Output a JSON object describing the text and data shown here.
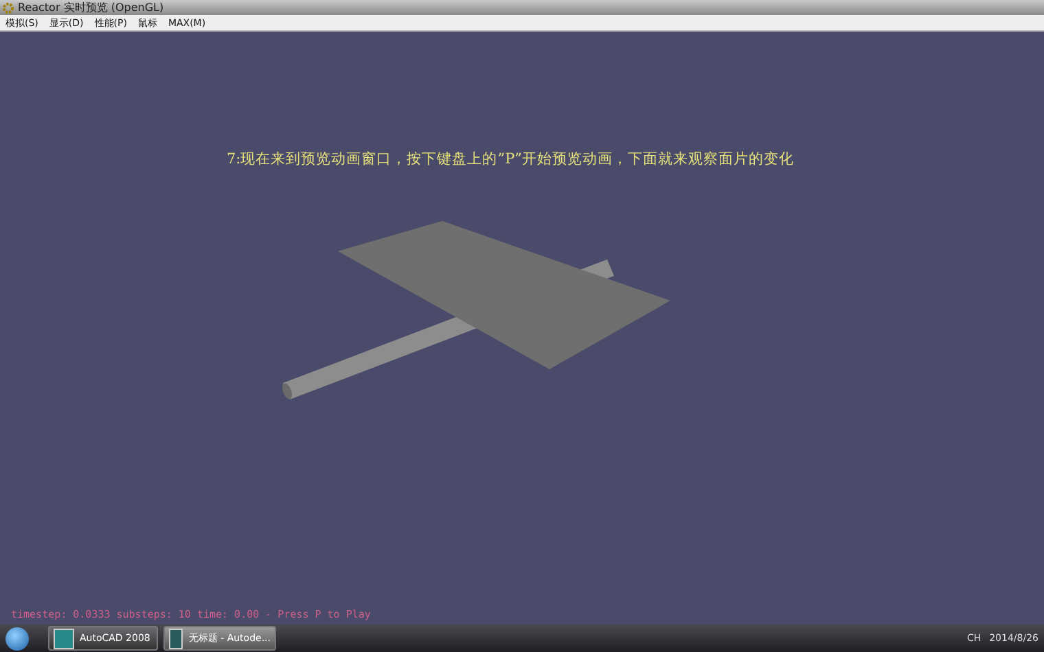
{
  "window": {
    "title": "Reactor 实时预览 (OpenGL)"
  },
  "menu": [
    "模拟(S)",
    "显示(D)",
    "性能(P)",
    "鼠标",
    "MAX(M)"
  ],
  "caption": "7:现在来到预览动画窗口，按下键盘上的”P”开始预览动画，下面就来观察面片的变化",
  "status_line": "timestep: 0.0333 substeps: 10 time: 0.00 - Press P to Play",
  "taskbar": {
    "items": [
      {
        "label": "AutoCAD 2008",
        "selected": false
      },
      {
        "label": "无标题 - Autode...",
        "selected": true
      }
    ],
    "language": "CH",
    "date": "2014/8/26"
  }
}
